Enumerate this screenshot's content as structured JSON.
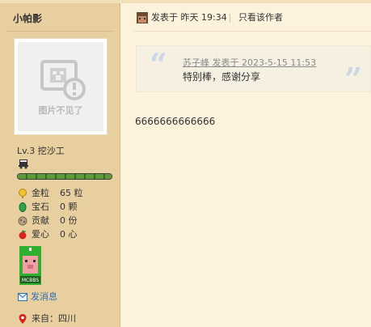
{
  "user": {
    "name": "小帕影",
    "avatar_caption": "图片不见了",
    "level": "Lv.3 挖沙工",
    "progress_fraction": 1.0,
    "stats": [
      {
        "label": "金粒",
        "value": "65 粒"
      },
      {
        "label": "宝石",
        "value": "0 颗"
      },
      {
        "label": "贡献",
        "value": "0 份"
      },
      {
        "label": "爱心",
        "value": "0 心"
      }
    ],
    "medal_text": "MCBBS",
    "send_message": "发消息",
    "from": "来自：四川"
  },
  "post": {
    "meta": "发表于 昨天 19:34",
    "only_author": "只看该作者",
    "quote": {
      "author_line": "苏子峰 发表于 2023-5-15 11:53",
      "text": "特别棒，感谢分享"
    },
    "body": "6666666666666"
  },
  "colors": {
    "sidebar_bg": "#e8cfa0",
    "content_bg": "#fdf3dc",
    "link": "#2b6fb3",
    "quote_mark": "#c9d7e6"
  },
  "icons": [
    "broken-image-icon",
    "minecart-icon",
    "gold-nugget-icon",
    "emerald-icon",
    "contribution-icon",
    "heart-apple-icon",
    "mail-icon",
    "location-pin-icon",
    "author-avatar-icon"
  ]
}
